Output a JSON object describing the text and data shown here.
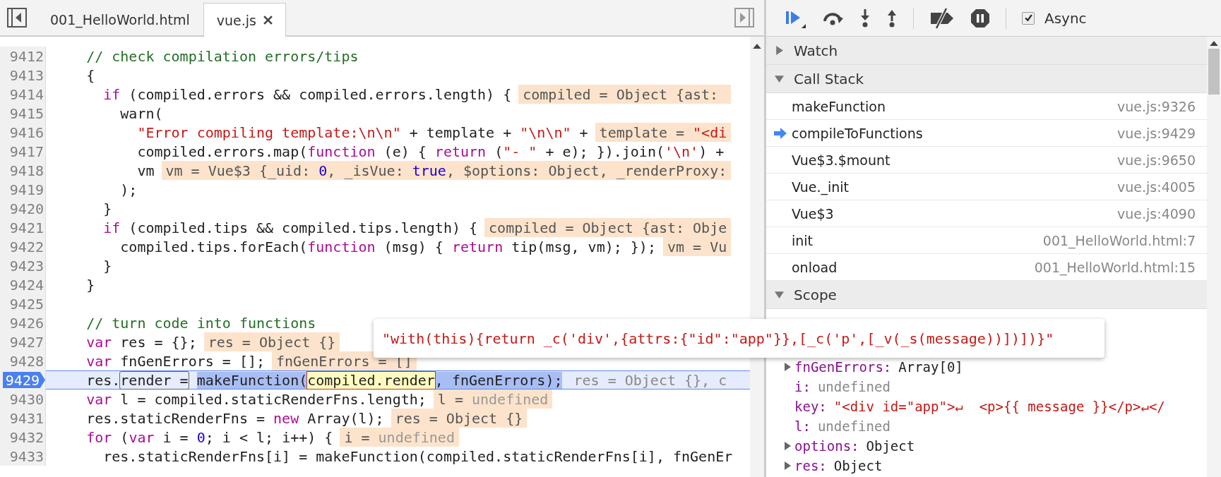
{
  "tabs": [
    {
      "label": "001_HelloWorld.html",
      "selected": false,
      "closable": false
    },
    {
      "label": "vue.js",
      "selected": true,
      "closable": true
    }
  ],
  "lines": [
    {
      "number": "9412",
      "current": false,
      "tokens": [
        {
          "kind": "comment",
          "text": "// check compilation errors/tips"
        }
      ]
    },
    {
      "number": "9413",
      "current": false,
      "tokens": [
        {
          "kind": "plain",
          "text": "{"
        }
      ],
      "children": [
        {
          "number": "9414",
          "current": false,
          "tokens": [
            {
              "kind": "keyword",
              "text": "if"
            },
            {
              "kind": "plain",
              "text": " (compiled.errors && compiled.errors.length) {"
            }
          ],
          "hint": [
            {
              "kind": "plain",
              "text": "compiled = Object {ast: "
            }
          ],
          "children": [
            {
              "number": "9415",
              "current": false,
              "tokens": [
                {
                  "kind": "plain",
                  "text": "warn("
                }
              ],
              "children": [
                {
                  "number": "9416",
                  "current": false,
                  "tokens": [
                    {
                      "kind": "string",
                      "text": "\"Error compiling template:\\n\\n\""
                    },
                    {
                      "kind": "plain",
                      "text": " + template + "
                    },
                    {
                      "kind": "string",
                      "text": "\"\\n\\n\""
                    },
                    {
                      "kind": "plain",
                      "text": " +"
                    }
                  ],
                  "hint": [
                    {
                      "kind": "plain",
                      "text": "template = "
                    },
                    {
                      "kind": "string",
                      "text": "\"<di"
                    }
                  ]
                },
                {
                  "number": "9417",
                  "current": false,
                  "tokens": [
                    {
                      "kind": "plain",
                      "text": "compiled.errors.map("
                    },
                    {
                      "kind": "keyword",
                      "text": "function"
                    },
                    {
                      "kind": "plain",
                      "text": " (e) { "
                    },
                    {
                      "kind": "keyword",
                      "text": "return"
                    },
                    {
                      "kind": "plain",
                      "text": " ("
                    },
                    {
                      "kind": "string",
                      "text": "\"- \""
                    },
                    {
                      "kind": "plain",
                      "text": " + e); }).join("
                    },
                    {
                      "kind": "string",
                      "text": "'\\n'"
                    },
                    {
                      "kind": "plain",
                      "text": ") +"
                    }
                  ]
                },
                {
                  "number": "9418",
                  "current": false,
                  "tokens": [
                    {
                      "kind": "plain",
                      "text": "vm"
                    }
                  ],
                  "hint": [
                    {
                      "kind": "plain",
                      "text": "vm = Vue$3 {_uid: "
                    },
                    {
                      "kind": "number",
                      "text": "0"
                    },
                    {
                      "kind": "plain",
                      "text": ", _isVue: "
                    },
                    {
                      "kind": "number",
                      "text": "true"
                    },
                    {
                      "kind": "plain",
                      "text": ", $options: Object, _renderProxy:"
                    }
                  ]
                }
              ]
            },
            {
              "number": "9419",
              "current": false,
              "tokens": [
                {
                  "kind": "plain",
                  "text": ");"
                }
              ]
            }
          ]
        },
        {
          "number": "9420",
          "current": false,
          "tokens": [
            {
              "kind": "plain",
              "text": "}"
            }
          ]
        },
        {
          "number": "9421",
          "current": false,
          "tokens": [
            {
              "kind": "keyword",
              "text": "if"
            },
            {
              "kind": "plain",
              "text": " (compiled.tips && compiled.tips.length) {"
            }
          ],
          "hint": [
            {
              "kind": "plain",
              "text": "compiled = Object {ast: Obje"
            }
          ],
          "children": [
            {
              "number": "9422",
              "current": false,
              "tokens": [
                {
                  "kind": "plain",
                  "text": "compiled.tips.forEach("
                },
                {
                  "kind": "keyword",
                  "text": "function"
                },
                {
                  "kind": "plain",
                  "text": " (msg) { "
                },
                {
                  "kind": "keyword",
                  "text": "return"
                },
                {
                  "kind": "plain",
                  "text": " tip(msg, vm); });"
                }
              ],
              "hint": [
                {
                  "kind": "plain",
                  "text": "vm = Vu"
                }
              ]
            }
          ]
        },
        {
          "number": "9423",
          "current": false,
          "tokens": [
            {
              "kind": "plain",
              "text": "}"
            }
          ]
        }
      ]
    },
    {
      "number": "9424",
      "current": false,
      "tokens": [
        {
          "kind": "plain",
          "text": "}"
        }
      ]
    },
    {
      "number": "9425",
      "current": false
    },
    {
      "number": "9426",
      "current": false,
      "tokens": [
        {
          "kind": "comment",
          "text": "// turn code into functions"
        }
      ]
    },
    {
      "number": "9427",
      "current": false,
      "tokens": [
        {
          "kind": "keyword",
          "text": "var"
        },
        {
          "kind": "plain",
          "text": " res = {};"
        }
      ],
      "hint": [
        {
          "kind": "plain",
          "text": "res = Object {}"
        }
      ]
    },
    {
      "number": "9428",
      "current": false,
      "tokens": [
        {
          "kind": "keyword",
          "text": "var"
        },
        {
          "kind": "plain",
          "text": " fnGenErrors = [];"
        }
      ],
      "hint": [
        {
          "kind": "plain",
          "text": "fnGenErrors = []"
        }
      ]
    },
    {
      "number": "9429",
      "current": true,
      "tokens": [
        {
          "kind": "plain",
          "text": "res."
        },
        {
          "kind": "boxed",
          "text": "render ="
        },
        {
          "kind": "selection",
          "text": "makeFunction("
        },
        {
          "kind": "evaluated",
          "text": "compiled.render"
        },
        {
          "kind": "selection",
          "text": ", fnGenErrors);"
        }
      ],
      "hint": [
        {
          "kind": "plain",
          "text": "res = Object {}, c"
        }
      ]
    },
    {
      "number": "9430",
      "current": false,
      "tokens": [
        {
          "kind": "keyword",
          "text": "var"
        },
        {
          "kind": "plain",
          "text": " l = compiled.staticRenderFns.length;"
        }
      ],
      "hint": [
        {
          "kind": "plain",
          "text": "l = "
        },
        {
          "kind": "undefined",
          "text": "undefined"
        }
      ]
    },
    {
      "number": "9431",
      "current": false,
      "tokens": [
        {
          "kind": "plain",
          "text": "res.staticRenderFns = "
        },
        {
          "kind": "keyword",
          "text": "new"
        },
        {
          "kind": "plain",
          "text": " Array(l);"
        }
      ],
      "hint": [
        {
          "kind": "plain",
          "text": "res = Object {}"
        }
      ]
    },
    {
      "number": "9432",
      "current": false,
      "tokens": [
        {
          "kind": "keyword",
          "text": "for"
        },
        {
          "kind": "plain",
          "text": " ("
        },
        {
          "kind": "keyword",
          "text": "var"
        },
        {
          "kind": "plain",
          "text": " i = "
        },
        {
          "kind": "number",
          "text": "0"
        },
        {
          "kind": "plain",
          "text": "; i < l; i++) {"
        }
      ],
      "hint": [
        {
          "kind": "plain",
          "text": "i = "
        },
        {
          "kind": "undefined",
          "text": "undefined"
        }
      ],
      "children": [
        {
          "number": "9433",
          "current": false,
          "tokens": [
            {
              "kind": "plain",
              "text": "res.staticRenderFns[i] = makeFunction(compiled.staticRenderFns[i], fnGenEr"
            }
          ]
        }
      ]
    }
  ],
  "tooltip": {
    "text": "\"with(this){return _c('div',{attrs:{\"id\":\"app\"}},[_c('p',[_v(_s(message))])])}\""
  },
  "async": {
    "label": "Async",
    "checked": true
  },
  "watch": {
    "title": "Watch",
    "expanded": false
  },
  "call_stack": {
    "title": "Call Stack",
    "expanded": true,
    "frames": [
      {
        "name": "makeFunction",
        "location": "vue.js:9326",
        "current": false
      },
      {
        "name": "compileToFunctions",
        "location": "vue.js:9429",
        "current": true
      },
      {
        "name": "Vue$3.$mount",
        "location": "vue.js:9650",
        "current": false
      },
      {
        "name": "Vue._init",
        "location": "vue.js:4005",
        "current": false
      },
      {
        "name": "Vue$3",
        "location": "vue.js:4090",
        "current": false
      },
      {
        "name": "init",
        "location": "001_HelloWorld.html:7",
        "current": false
      },
      {
        "name": "onload",
        "location": "001_HelloWorld.html:15",
        "current": false
      }
    ]
  },
  "scope": {
    "title": "Scope",
    "expanded": true,
    "variables": [
      {
        "name": "fnGenErrors:",
        "value": "Array[0]",
        "kind": "object",
        "expandable": true
      },
      {
        "name": "i:",
        "value": "undefined",
        "kind": "undefined",
        "expandable": false
      },
      {
        "name": "key:",
        "value": "\"<div id=\"app\">↵  <p>{{ message }}</p>↵</",
        "kind": "string",
        "expandable": false
      },
      {
        "name": "l:",
        "value": "undefined",
        "kind": "undefined",
        "expandable": false
      },
      {
        "name": "options:",
        "value": "Object",
        "kind": "object",
        "expandable": true
      },
      {
        "name": "res:",
        "value": "Object",
        "kind": "object",
        "expandable": true
      }
    ]
  }
}
